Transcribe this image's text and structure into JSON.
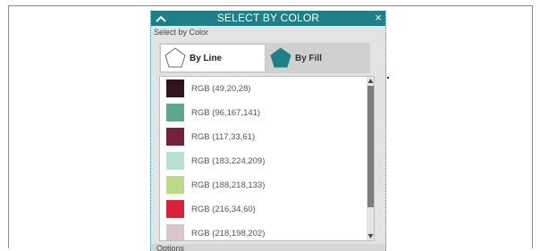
{
  "dialog": {
    "title": "SELECT BY COLOR",
    "close_icon": "×",
    "section_label": "Select by Color"
  },
  "modes": {
    "line_label": "By Line",
    "fill_label": "By Fill",
    "active": "By Line"
  },
  "colors": [
    {
      "label": "RGB (49,20,28)",
      "hex": "#31141c"
    },
    {
      "label": "RGB (96,167,141)",
      "hex": "#60a78d"
    },
    {
      "label": "RGB (117,33,61)",
      "hex": "#75213d"
    },
    {
      "label": "RGB (183,224,209)",
      "hex": "#b7e0d1"
    },
    {
      "label": "RGB (188,218,133)",
      "hex": "#bcda85"
    },
    {
      "label": "RGB (216,34,60)",
      "hex": "#d8223c"
    },
    {
      "label": "RGB (218,198,202)",
      "hex": "#dac6ca"
    }
  ],
  "options_label": "Options",
  "theme": {
    "title_bar": "#1e7f86",
    "fill_icon": "#1e7f86"
  }
}
